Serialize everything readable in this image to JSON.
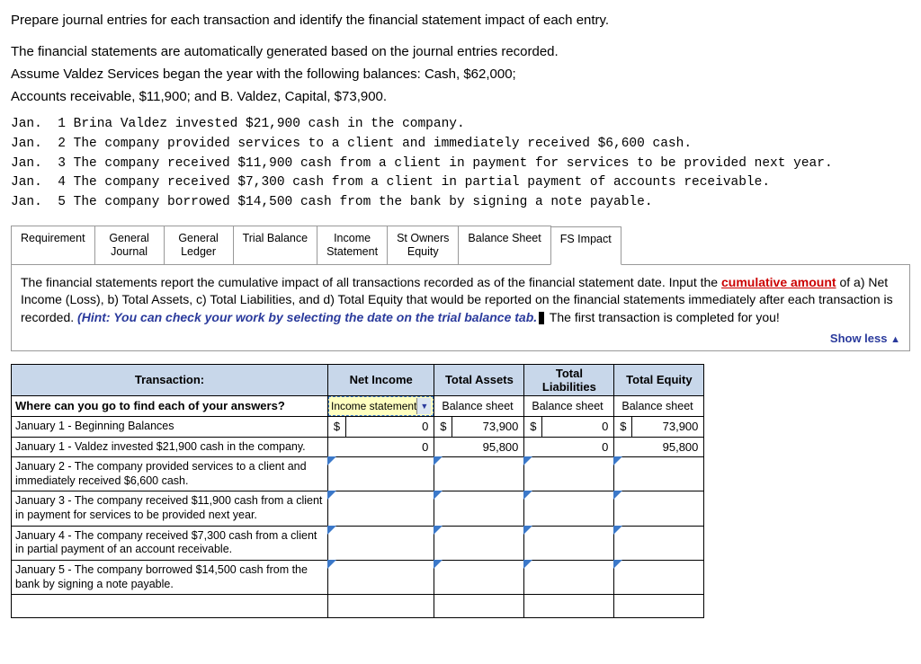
{
  "instructions": {
    "line1": "Prepare journal entries for each transaction and identify the financial statement impact of each entry.",
    "line2": "The financial statements are automatically generated based on the journal entries recorded.",
    "line3": "Assume Valdez Services began the year with the following balances:  Cash, $62,000;",
    "line4": "Accounts receivable, $11,900; and B. Valdez, Capital, $73,900."
  },
  "journal_lines": "Jan.  1 Brina Valdez invested $21,900 cash in the company.\nJan.  2 The company provided services to a client and immediately received $6,600 cash.\nJan.  3 The company received $11,900 cash from a client in payment for services to be provided next year.\nJan.  4 The company received $7,300 cash from a client in partial payment of accounts receivable.\nJan.  5 The company borrowed $14,500 cash from the bank by signing a note payable.",
  "tabs": [
    {
      "label": "Requirement"
    },
    {
      "label": "General\nJournal"
    },
    {
      "label": "General\nLedger"
    },
    {
      "label": "Trial Balance"
    },
    {
      "label": "Income\nStatement"
    },
    {
      "label": "St Owners\nEquity"
    },
    {
      "label": "Balance Sheet"
    },
    {
      "label": "FS Impact"
    }
  ],
  "hint": {
    "p1a": "The financial statements report the cumulative impact of all transactions recorded as of the financial statement date.   Input the ",
    "p1b": "cumulative amount",
    "p1c": " of a) Net Income (Loss), b)  Total Assets, c) Total Liabilities, and d)  Total Equity that would be reported on the financial statements immediately after each transaction is recorded.  ",
    "p1d": "(Hint:  You can check your work by selecting the date on the trial balance tab.",
    "p1e": " The first transaction is completed for you!"
  },
  "show_less": "Show less",
  "table": {
    "headers": {
      "transaction": "Transaction:",
      "net_income": "Net Income",
      "total_assets": "Total Assets",
      "total_liab": "Total\nLiabilities",
      "total_equity": "Total Equity"
    },
    "question": "Where can you go to find each of your answers?",
    "answers": {
      "net_income": "Income statement",
      "total_assets": "Balance sheet",
      "total_liab": "Balance sheet",
      "total_equity": "Balance sheet"
    },
    "rows": [
      {
        "label": "January 1 -  Beginning Balances",
        "net_income_sym": "$",
        "net_income": "0",
        "assets_sym": "$",
        "assets": "73,900",
        "liab_sym": "$",
        "liab": "0",
        "equity_sym": "$",
        "equity": "73,900"
      },
      {
        "label": "January 1 -  Valdez invested $21,900 cash in the company.",
        "net_income": "0",
        "assets": "95,800",
        "liab": "0",
        "equity": "95,800"
      },
      {
        "label": "January 2 - The company provided services to a client and immediately received $6,600 cash."
      },
      {
        "label": "January 3 - The company received $11,900 cash from a client in payment for services to be provided next year."
      },
      {
        "label": "January 4 - The company received $7,300 cash from a client in partial payment of an account receivable."
      },
      {
        "label": "January 5 - The company borrowed $14,500 cash from the bank by signing a note payable."
      }
    ]
  }
}
